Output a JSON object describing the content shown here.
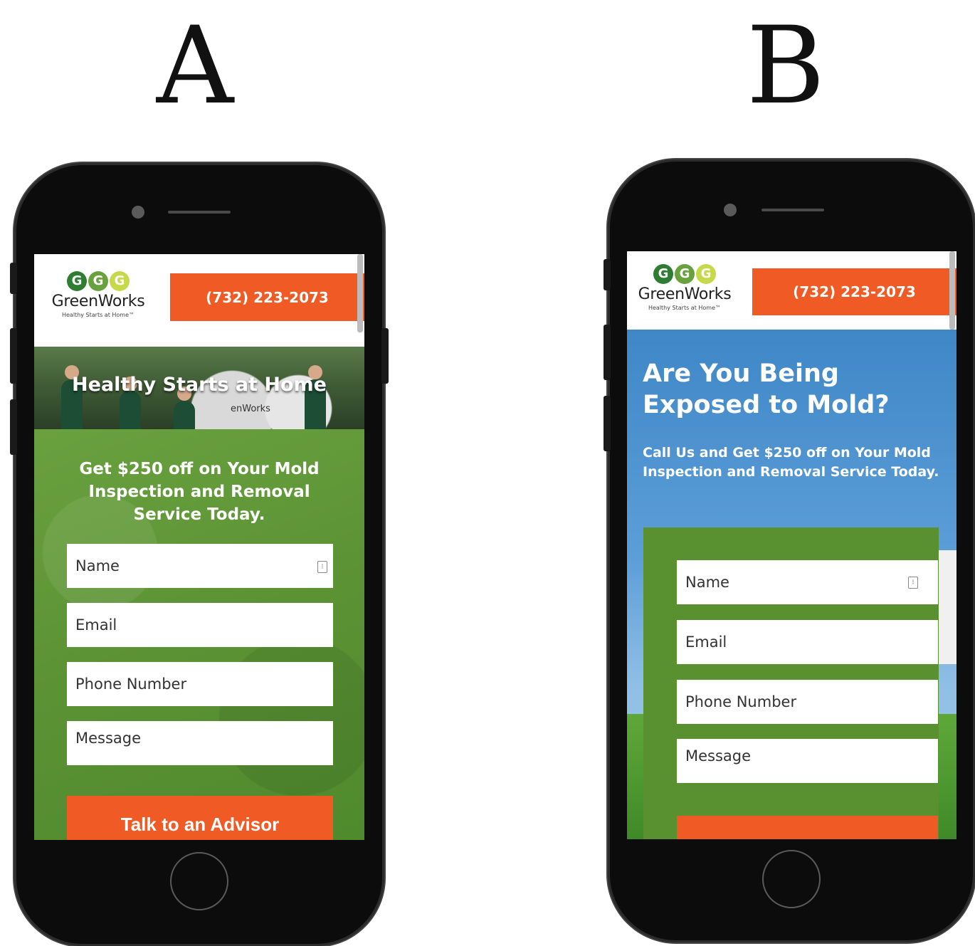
{
  "variants": {
    "a": {
      "label": "A"
    },
    "b": {
      "label": "B"
    }
  },
  "brand": {
    "logo_letters": [
      "G",
      "G",
      "G"
    ],
    "name": "GreenWorks",
    "tagline": "Healthy Starts at Home™",
    "phone": "(732) 223-2073",
    "colors": {
      "accent": "#f05a24",
      "green": "#5a9130",
      "logo_dark": "#2e7d32",
      "logo_mid": "#6aa13f",
      "logo_light": "#c6d94a"
    }
  },
  "variant_a": {
    "hero_heading": "Healthy Starts at Home",
    "van_text": "enWorks",
    "offer": "Get $250 off on Your Mold Inspection and Removal Service Today.",
    "fields": {
      "name": "Name",
      "email": "Email",
      "phone": "Phone Number",
      "message": "Message"
    },
    "cta": "Talk to an Advisor"
  },
  "variant_b": {
    "heading": "Are You Being Exposed to Mold?",
    "sub": "Call Us and Get $250 off on Your Mold Inspection and Removal Service Today.",
    "fields": {
      "name": "Name",
      "email": "Email",
      "phone": "Phone Number",
      "message": "Message"
    }
  }
}
